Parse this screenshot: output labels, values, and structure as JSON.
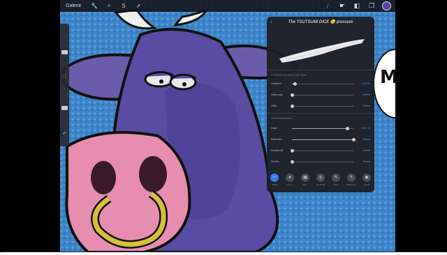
{
  "toolbar": {
    "gallery_label": "Galerie",
    "left_tools": [
      {
        "icon": "wrench-icon",
        "glyph": "🔧"
      },
      {
        "icon": "magic-wand-icon",
        "glyph": "✧"
      },
      {
        "icon": "selection-icon",
        "glyph": "S"
      },
      {
        "icon": "transform-icon",
        "glyph": "➚"
      }
    ],
    "right_tools": [
      {
        "icon": "brush-icon",
        "glyph": "/"
      },
      {
        "icon": "smudge-icon",
        "glyph": "☛"
      },
      {
        "icon": "eraser-icon",
        "glyph": "◧"
      },
      {
        "icon": "layers-icon",
        "glyph": "❐"
      }
    ],
    "active_color": "#5a40b0"
  },
  "sidebar": {
    "undo_glyph": "↶"
  },
  "brush_panel": {
    "title": "The TSUTSUMI DICE 😊 pressure",
    "sections": [
      {
        "title": "FORMEIGENSCHAFTEN",
        "rows": [
          {
            "label": "Abstand",
            "value": "12.9 %",
            "level": 0.05
          },
          {
            "label": "Streuung",
            "value": "Keine",
            "level": 0.0
          },
          {
            "label": "Jitter",
            "value": "Keine",
            "level": 0.0
          }
        ]
      },
      {
        "title": "VERJÜNGUNG",
        "rows": [
          {
            "label": "Start",
            "value": "33.0 %",
            "level": 0.9
          },
          {
            "label": "Beenden",
            "value": "Keine",
            "level": 1.0
          },
          {
            "label": "Deckkraft",
            "value": "Keine",
            "level": 0.0
          },
          {
            "label": "Größe",
            "value": "Keine",
            "level": 0.0
          }
        ]
      }
    ],
    "tabs": [
      {
        "label": "Strich",
        "glyph": "〰"
      },
      {
        "label": "Form",
        "glyph": "●"
      },
      {
        "label": "Korn",
        "glyph": "▦"
      },
      {
        "label": "Dynamik",
        "glyph": "◎"
      },
      {
        "label": "Pencil",
        "glyph": "✎"
      },
      {
        "label": "Allgemein",
        "glyph": "✎"
      },
      {
        "label": "Quelle",
        "glyph": "◉"
      }
    ]
  },
  "speech_bubble_text": "M"
}
